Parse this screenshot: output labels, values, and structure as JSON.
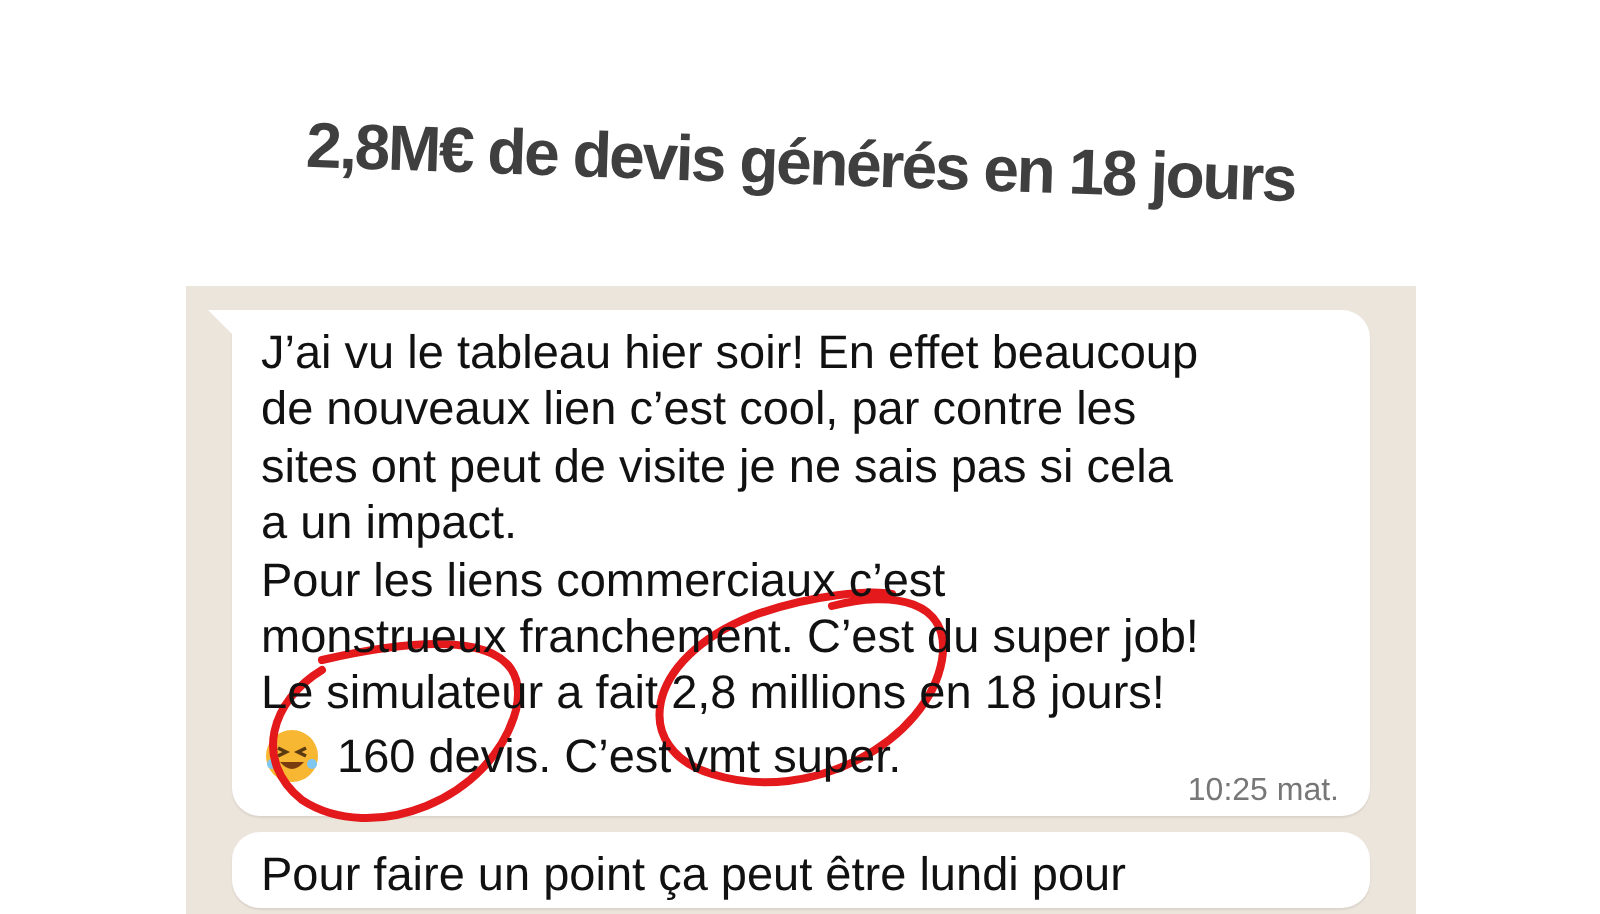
{
  "title": "2,8M€ de devis générés en 18 jours",
  "messages": [
    {
      "lines": [
        "J’ai vu le tableau hier soir! En effet beaucoup",
        "de nouveaux lien c’est cool, par contre les",
        "sites ont peut de visite je ne sais pas si cela",
        "a un impact.",
        "Pour les liens commerciaux c’est",
        "monstrueux franchement. C’est du super job!",
        "Le simulateur a fait 2,8 millions en 18 jours!"
      ],
      "emoji_line": "160 devis. C’est vmt super.",
      "time": "10:25 mat.",
      "tail": true
    },
    {
      "lines": [
        "Pour faire un point ça peut être lundi pour"
      ],
      "tail": false
    }
  ]
}
